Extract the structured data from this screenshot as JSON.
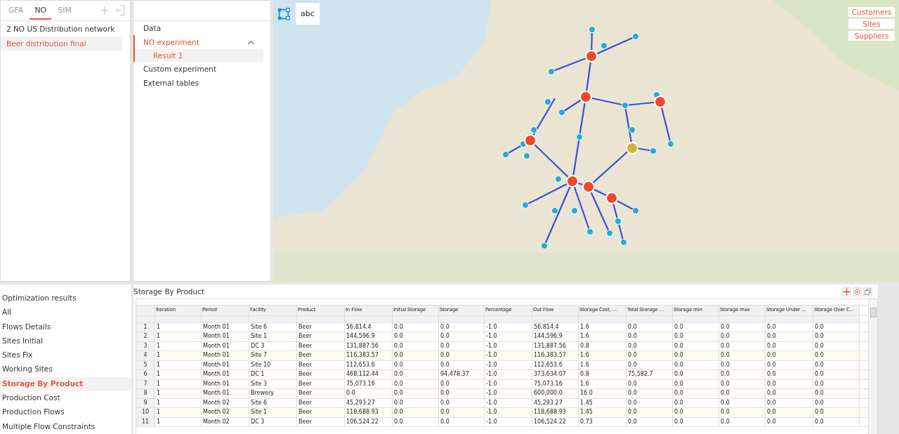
{
  "tabs": [
    {
      "label": "GFA",
      "selected": false
    },
    {
      "label": "NO",
      "selected": true
    },
    {
      "label": "SIM",
      "selected": false
    }
  ],
  "projects": [
    {
      "label": "2 NO US Distribution network",
      "selected": false
    },
    {
      "label": "Beer distribution final",
      "selected": true
    }
  ],
  "tree": [
    {
      "label": "Data",
      "selected": false
    },
    {
      "label": "NO experiment",
      "selected": true,
      "expanded": true,
      "children": [
        {
          "label": "Result 1",
          "selected": true
        }
      ]
    },
    {
      "label": "Custom experiment",
      "selected": false
    },
    {
      "label": "External tables",
      "selected": false
    }
  ],
  "map": {
    "label_toggle": "abc",
    "layers": [
      "Customers",
      "Sites",
      "Suppliers"
    ]
  },
  "results": [
    {
      "label": "Optimization results",
      "selected": false
    },
    {
      "label": "All",
      "selected": false
    },
    {
      "label": "Flows Details",
      "selected": false
    },
    {
      "label": "Sites Initial",
      "selected": false
    },
    {
      "label": "Sites Fix",
      "selected": false
    },
    {
      "label": "Working Sites",
      "selected": false
    },
    {
      "label": "Storage By Product",
      "selected": true
    },
    {
      "label": "Production Cost",
      "selected": false
    },
    {
      "label": "Production Flows",
      "selected": false
    },
    {
      "label": "Multiple Flow Constraints",
      "selected": false
    }
  ],
  "table": {
    "title": "Storage By Product",
    "columns": [
      "Iteration",
      "Period",
      "Facility",
      "Product",
      "In Flow",
      "Initial Storage",
      "Storage",
      "Percentage",
      "Out Flow",
      "Storage Cost, ...",
      "Total Storage ...",
      "Storage min",
      "Storage max",
      "Storage Under ...",
      "Storage Over C..."
    ],
    "rows": [
      {
        "number": "1",
        "cells": [
          "1",
          "Month 01",
          "Site 6",
          "Beer",
          "56,814.4",
          "0.0",
          "0.0",
          "-1.0",
          "56,814.4",
          "1.6",
          "0.0",
          "0.0",
          "0.0",
          "0.0",
          "0.0"
        ]
      },
      {
        "number": "2",
        "cells": [
          "1",
          "Month 01",
          "Site 1",
          "Beer",
          "144,596.9",
          "0.0",
          "0.0",
          "-1.0",
          "144,596.9",
          "1.6",
          "0.0",
          "0.0",
          "0.0",
          "0.0",
          "0.0"
        ]
      },
      {
        "number": "3",
        "cells": [
          "1",
          "Month 01",
          "DC 3",
          "Beer",
          "131,887.56",
          "0.0",
          "0.0",
          "-1.0",
          "131,887.56",
          "0.8",
          "0.0",
          "0.0",
          "0.0",
          "0.0",
          "0.0"
        ]
      },
      {
        "number": "4",
        "cells": [
          "1",
          "Month 01",
          "Site 7",
          "Beer",
          "116,383.57",
          "0.0",
          "0.0",
          "-1.0",
          "116,383.57",
          "1.6",
          "0.0",
          "0.0",
          "0.0",
          "0.0",
          "0.0"
        ]
      },
      {
        "number": "5",
        "cells": [
          "1",
          "Month 01",
          "Site 10",
          "Beer",
          "112,653.6",
          "0.0",
          "0.0",
          "-1.0",
          "112,653.6",
          "1.6",
          "0.0",
          "0.0",
          "0.0",
          "0.0",
          "0.0"
        ]
      },
      {
        "number": "6",
        "cells": [
          "1",
          "Month 01",
          "DC 1",
          "Beer",
          "468,112.44",
          "0.0",
          "94,478.37",
          "-1.0",
          "373,634.07",
          "0.8",
          "75,582.7",
          "0.0",
          "0.0",
          "0.0",
          "0.0"
        ]
      },
      {
        "number": "7",
        "cells": [
          "1",
          "Month 01",
          "Site 3",
          "Beer",
          "75,073.16",
          "0.0",
          "0.0",
          "-1.0",
          "75,073.16",
          "1.6",
          "0.0",
          "0.0",
          "0.0",
          "0.0",
          "0.0"
        ]
      },
      {
        "number": "8",
        "cells": [
          "1",
          "Month 01",
          "Brewery",
          "Beer",
          "0.0",
          "0.0",
          "0.0",
          "-1.0",
          "600,000.0",
          "16.0",
          "0.0",
          "0.0",
          "0.0",
          "0.0",
          "0.0"
        ]
      },
      {
        "number": "9",
        "cells": [
          "1",
          "Month 02",
          "Site 6",
          "Beer",
          "45,293.27",
          "0.0",
          "0.0",
          "-1.0",
          "45,293.27",
          "1.45",
          "0.0",
          "0.0",
          "0.0",
          "0.0",
          "0.0"
        ]
      },
      {
        "number": "10",
        "cells": [
          "1",
          "Month 02",
          "Site 1",
          "Beer",
          "118,688.93",
          "0.0",
          "0.0",
          "-1.0",
          "118,688.93",
          "1.45",
          "0.0",
          "0.0",
          "0.0",
          "0.0",
          "0.0"
        ]
      },
      {
        "number": "11",
        "cells": [
          "1",
          "Month 02",
          "DC 3",
          "Beer",
          "106,524.22",
          "0.0",
          "0.0",
          "-1.0",
          "106,524.22",
          "0.73",
          "0.0",
          "0.0",
          "0.0",
          "0.0",
          "0.0"
        ]
      }
    ]
  }
}
